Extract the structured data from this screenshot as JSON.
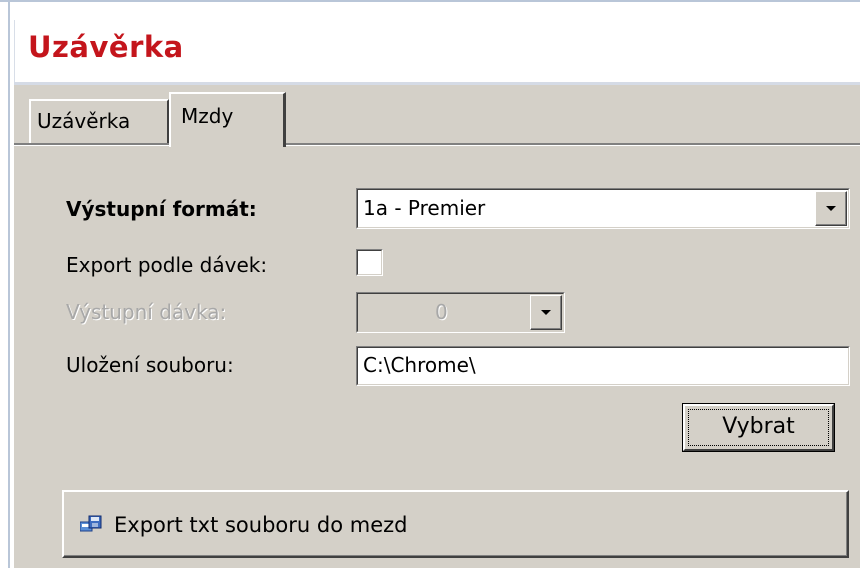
{
  "window": {
    "title": "Uzávěrka"
  },
  "tabs": [
    {
      "label": "Uzávěrka",
      "active": false
    },
    {
      "label": "Mzdy",
      "active": true
    }
  ],
  "form": {
    "output_format_label": "Výstupní formát:",
    "output_format_value": "1a - Premier",
    "export_by_batches_label": "Export podle dávek:",
    "export_by_batches_checked": false,
    "output_batch_label": "Výstupní dávka:",
    "output_batch_value": "0",
    "output_batch_enabled": false,
    "file_location_label": "Uložení souboru:",
    "file_location_value": "C:\\Chrome\\",
    "select_button_label": "Vybrat",
    "export_button_label": "Export txt souboru do mezd",
    "export_button_icon": "export-floppy-icon"
  }
}
